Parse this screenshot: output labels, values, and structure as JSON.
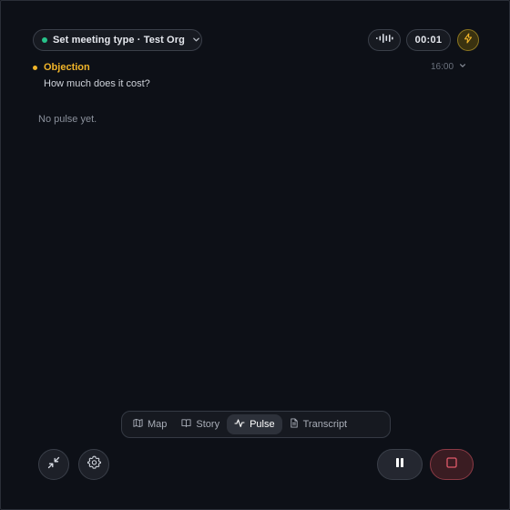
{
  "header": {
    "meeting_type_label": "Set meeting type · Test Org",
    "timer": "00:01",
    "status_color": "#27c28a",
    "accent_color": "#f0b429"
  },
  "objection": {
    "category": "Objection",
    "time": "16:00",
    "text": "How much does it cost?"
  },
  "pulse": {
    "empty_message": "No pulse yet."
  },
  "tabs": [
    {
      "label": "Map",
      "icon": "map-icon",
      "active": false
    },
    {
      "label": "Story",
      "icon": "book-icon",
      "active": false
    },
    {
      "label": "Pulse",
      "icon": "pulse-icon",
      "active": true
    },
    {
      "label": "Transcript",
      "icon": "document-icon",
      "active": false
    }
  ],
  "controls": {
    "collapse_icon": "collapse-icon",
    "settings_icon": "gear-icon",
    "pause_icon": "pause-icon",
    "stop_icon": "stop-icon",
    "stop_color": "#e05a6a"
  }
}
